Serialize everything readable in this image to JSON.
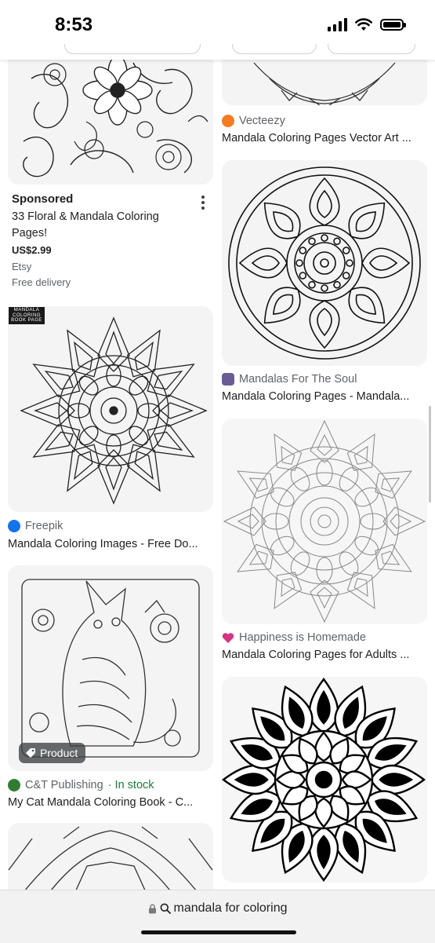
{
  "status_bar": {
    "time": "8:53"
  },
  "ad": {
    "label": "Sponsored",
    "title": "33 Floral & Mandala Coloring Pages!",
    "price": "US$2.99",
    "shop": "Etsy",
    "delivery": "Free delivery"
  },
  "left_results": [
    {
      "source": "Freepik",
      "title": "Mandala Coloring Images - Free Do...",
      "logo_text": "MANDALA COLORING BOOK PAGE"
    },
    {
      "source": "C&T Publishing",
      "source_extra": " · In stock",
      "title": "My Cat Mandala Coloring Book - C...",
      "badge": "Product"
    }
  ],
  "right_results": [
    {
      "source": "Vecteezy",
      "title": "Mandala Coloring Pages Vector Art ..."
    },
    {
      "source": "Mandalas For The Soul",
      "title": "Mandala Coloring Pages - Mandala..."
    },
    {
      "source": "Happiness is Homemade",
      "title": "Mandala Coloring Pages for Adults ..."
    }
  ],
  "url_bar": {
    "query": "mandala for coloring"
  },
  "colors": {
    "vecteezy": "#f47c20",
    "freepik": "#1273eb",
    "ct": "#2e7d32",
    "instock": "#188038",
    "heart": "#d63384"
  }
}
